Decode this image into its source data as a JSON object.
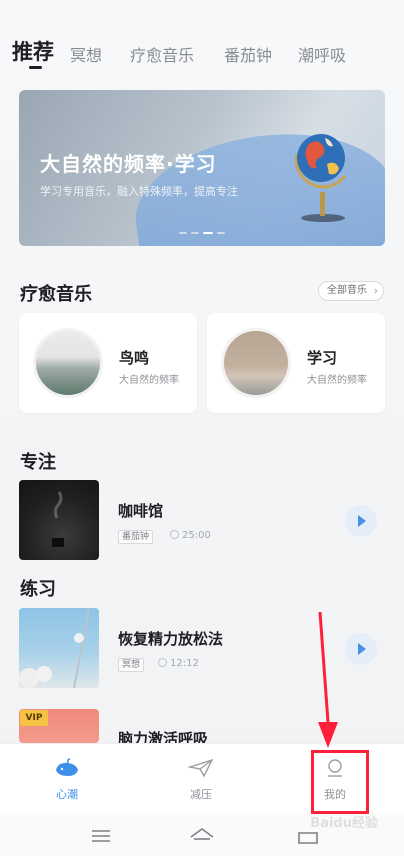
{
  "tabs": [
    {
      "label": "推荐"
    },
    {
      "label": "冥想"
    },
    {
      "label": "疗愈音乐"
    },
    {
      "label": "番茄钟"
    },
    {
      "label": "潮呼吸"
    }
  ],
  "banner": {
    "title": "大自然的频率·学习",
    "subtitle": "学习专用音乐，融入特殊频率，提高专注",
    "page_indicator": {
      "count": 4,
      "active_index": 2
    }
  },
  "healing_music": {
    "title": "疗愈音乐",
    "all_button_label": "全部音乐",
    "cards": [
      {
        "name": "鸟鸣",
        "desc": "大自然的频率"
      },
      {
        "name": "学习",
        "desc": "大自然的频率"
      }
    ]
  },
  "focus": {
    "title": "专注",
    "items": [
      {
        "title": "咖啡馆",
        "tag": "番茄钟",
        "duration": "25:00"
      }
    ]
  },
  "practice": {
    "title": "练习",
    "items": [
      {
        "title": "恢复精力放松法",
        "tag": "冥想",
        "duration": "12:12"
      },
      {
        "title": "脑力激活呼吸",
        "badge": "VIP"
      }
    ]
  },
  "bottom_nav": [
    {
      "label": "心潮",
      "icon": "whale-icon",
      "active": true
    },
    {
      "label": "减压",
      "icon": "paper-plane-icon",
      "active": false
    },
    {
      "label": "我的",
      "icon": "profile-icon",
      "active": false
    }
  ],
  "system_nav": [
    "menu-icon",
    "home-icon",
    "back-icon"
  ],
  "watermark": "Baidu经验",
  "colors": {
    "accent": "#3f8fe8",
    "highlight": "#ff1f3b",
    "vip": "#f6c243"
  }
}
